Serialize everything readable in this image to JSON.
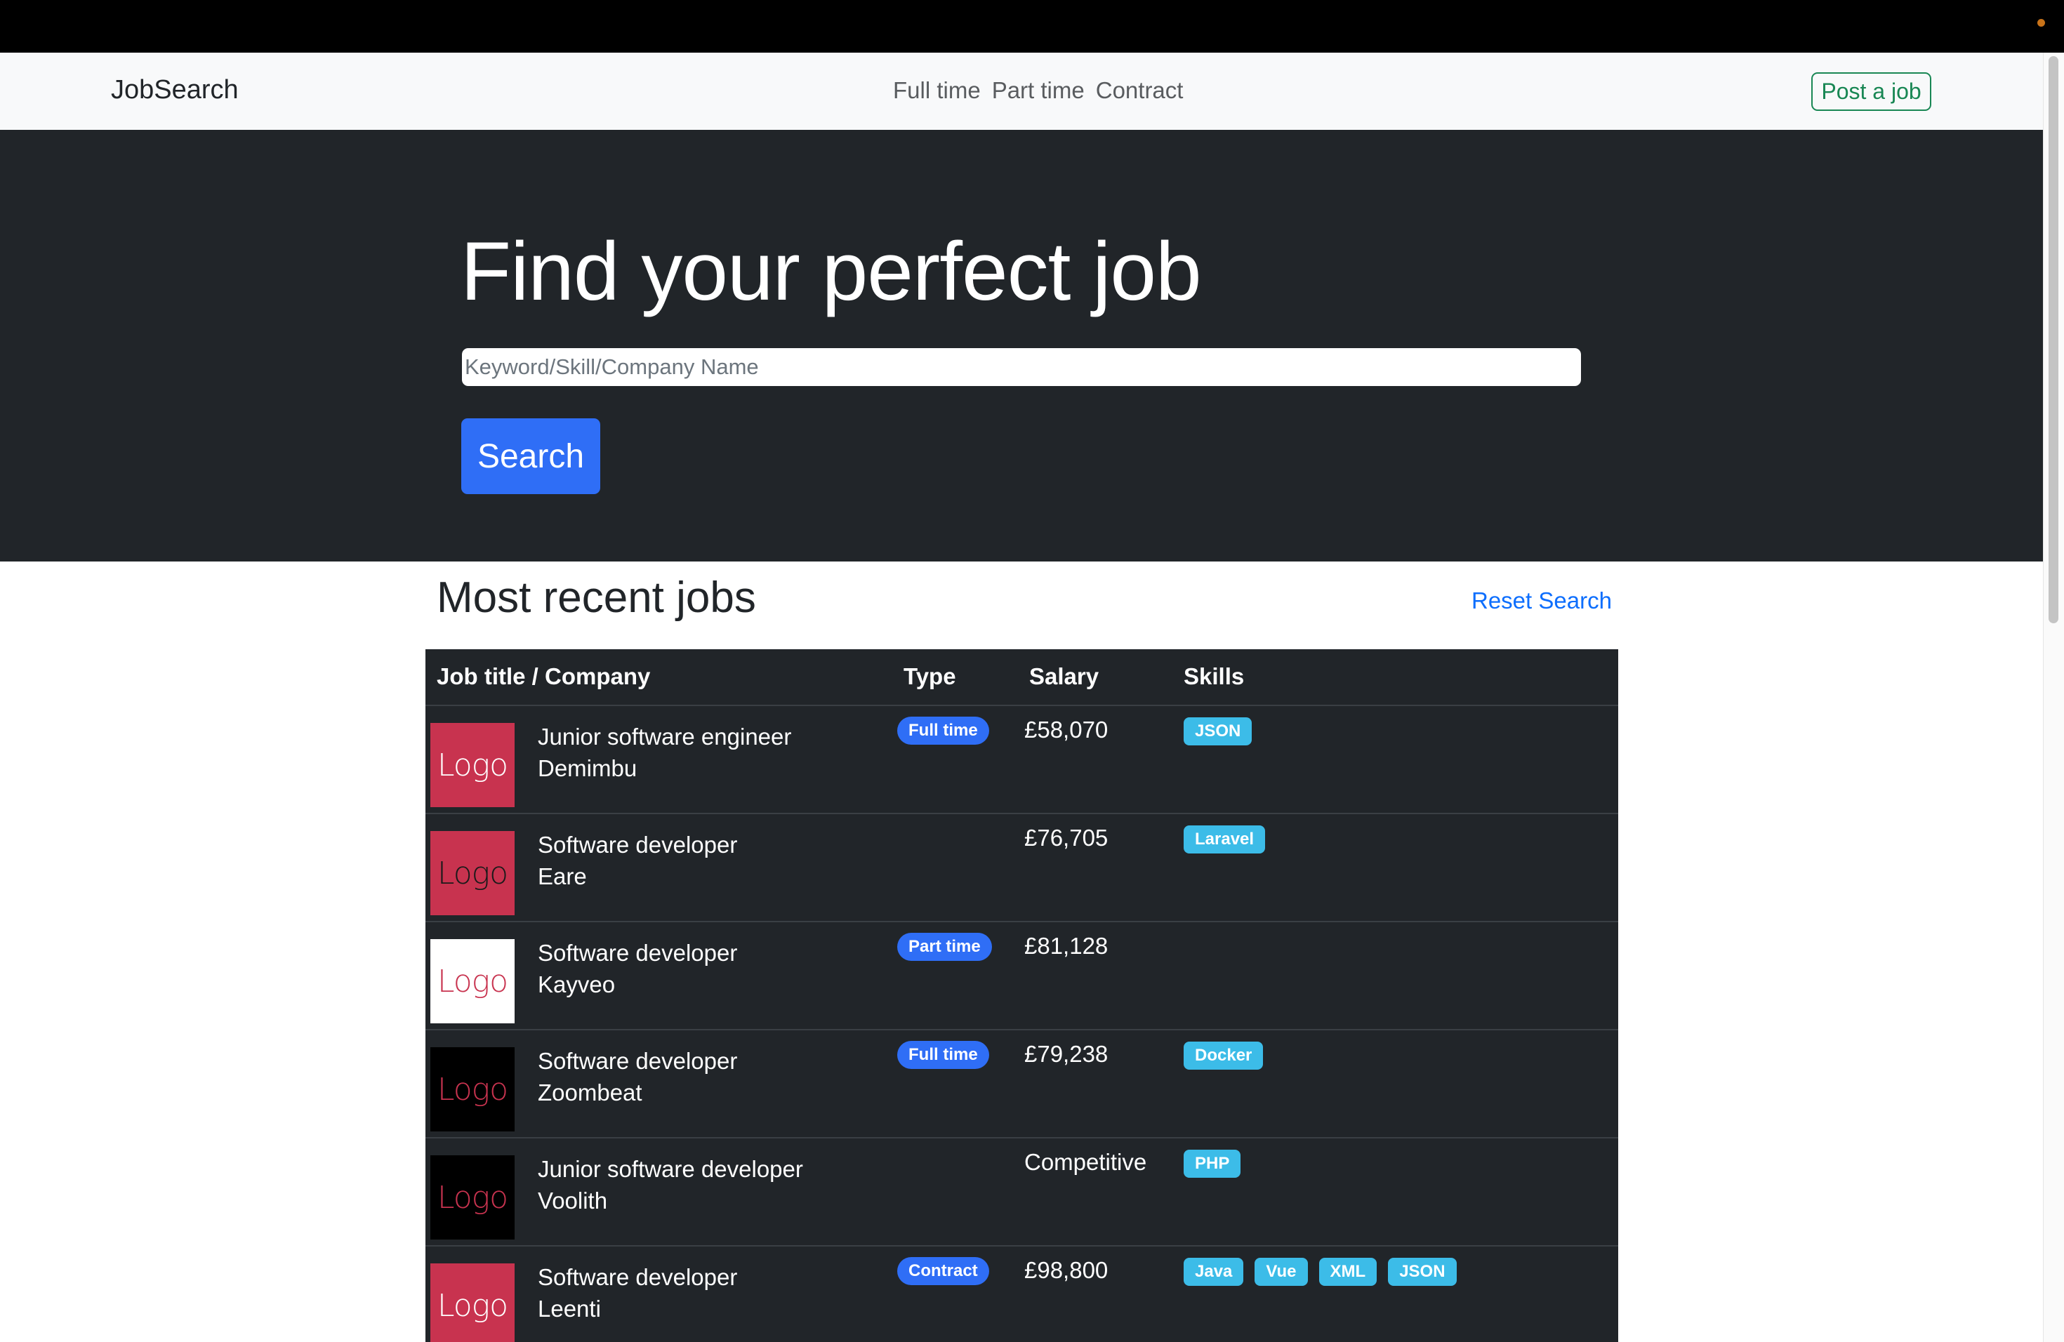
{
  "colors": {
    "navbar_bg": "#f8f9fa",
    "hero_bg": "#212529",
    "primary": "#2f6ef6",
    "success": "#198754",
    "link": "#0d6efd",
    "skill_badge": "#3cbce8",
    "table_bg": "#212529"
  },
  "navbar": {
    "brand": "JobSearch",
    "links": [
      "Full time",
      "Part time",
      "Contract"
    ],
    "post_button": "Post a job"
  },
  "hero": {
    "title": "Find your perfect job",
    "search_placeholder": "Keyword/Skill/Company Name",
    "search_value": "",
    "search_button": "Search"
  },
  "recent": {
    "title": "Most recent jobs",
    "reset_link": "Reset Search"
  },
  "table": {
    "headers": [
      "Job title / Company",
      "Type",
      "Salary",
      "Skills"
    ],
    "rows": [
      {
        "logo_text": "Logo",
        "logo_bg": "#c8334f",
        "logo_fg": "#ffffff",
        "title": "Junior software engineer",
        "company": "Demimbu",
        "type": "Full time",
        "salary": "£58,070",
        "skills": [
          "JSON"
        ]
      },
      {
        "logo_text": "Logo",
        "logo_bg": "#c8334f",
        "logo_fg": "#1a1a1a",
        "title": "Software developer",
        "company": "Eare",
        "type": "",
        "salary": "£76,705",
        "skills": [
          "Laravel"
        ]
      },
      {
        "logo_text": "Logo",
        "logo_bg": "#ffffff",
        "logo_fg": "#c8334f",
        "title": "Software developer",
        "company": "Kayveo",
        "type": "Part time",
        "salary": "£81,128",
        "skills": []
      },
      {
        "logo_text": "Logo",
        "logo_bg": "#000000",
        "logo_fg": "#c8334f",
        "title": "Software developer",
        "company": "Zoombeat",
        "type": "Full time",
        "salary": "£79,238",
        "skills": [
          "Docker"
        ]
      },
      {
        "logo_text": "Logo",
        "logo_bg": "#000000",
        "logo_fg": "#c8334f",
        "title": "Junior software developer",
        "company": "Voolith",
        "type": "",
        "salary": "Competitive",
        "skills": [
          "PHP"
        ]
      },
      {
        "logo_text": "Logo",
        "logo_bg": "#c8334f",
        "logo_fg": "#ffffff",
        "title": "Software developer",
        "company": "Leenti",
        "type": "Contract",
        "salary": "£98,800",
        "skills": [
          "Java",
          "Vue",
          "XML",
          "JSON"
        ]
      }
    ]
  }
}
